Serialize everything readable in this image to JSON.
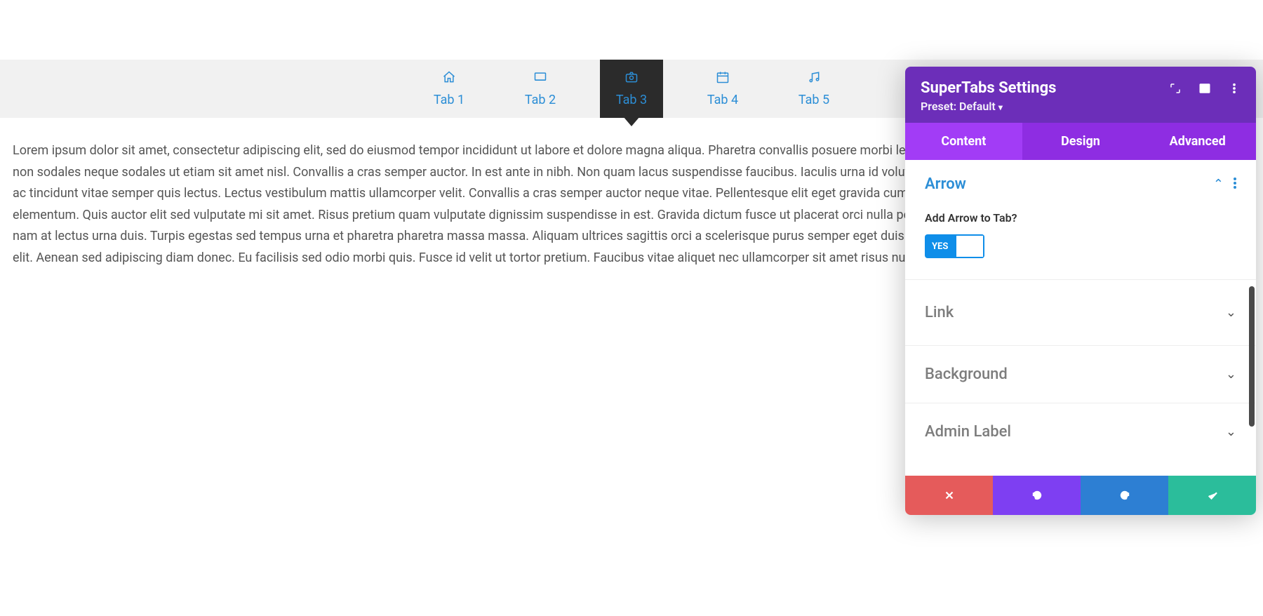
{
  "preview": {
    "tabs": [
      {
        "label": "Tab 1",
        "icon": "home",
        "active": false
      },
      {
        "label": "Tab 2",
        "icon": "monitor",
        "active": false
      },
      {
        "label": "Tab 3",
        "icon": "camera",
        "active": true
      },
      {
        "label": "Tab 4",
        "icon": "calendar",
        "active": false
      },
      {
        "label": "Tab 5",
        "icon": "music",
        "active": false
      }
    ],
    "content": "Lorem ipsum dolor sit amet, consectetur adipiscing elit, sed do eiusmod tempor incididunt ut labore et dolore magna aliqua. Pharetra convallis posuere morbi leo urna. Mi bibendum neque egestas congue quisque. Arcu non sodales neque sodales ut etiam sit amet nisl. Convallis a cras semper auctor. In est ante in nibh. Non quam lacus suspendisse faucibus. Iaculis urna id volutpat lacus laoreet non curabitur gravida arcu. Neque volutpat ac tincidunt vitae semper quis lectus. Lectus vestibulum mattis ullamcorper velit. Convallis a cras semper auctor neque vitae. Pellentesque elit eget gravida cum. Porttitor rhoncus dolor purus non enim praesent elementum. Quis auctor elit sed vulputate mi sit amet. Risus pretium quam vulputate dignissim suspendisse in est. Gravida dictum fusce ut placerat orci nulla pellentesque. Id volutpat lacus laoreet non. Consectetur a erat nam at lectus urna duis. Turpis egestas sed tempus urna et pharetra pharetra massa massa. Aliquam ultrices sagittis orci a scelerisque purus semper eget duis. Posuere lorem ipsum dolor sit amet consectetur adipiscing elit. Aenean sed adipiscing diam donec. Eu facilisis sed odio morbi quis. Fusce id velit ut tortor pretium. Faucibus vitae aliquet nec ullamcorper sit amet risus nullam eget. Eleifend mi in nulla posuere sollicitudin."
  },
  "panel": {
    "title": "SuperTabs Settings",
    "preset": "Preset: Default",
    "tabs": {
      "content": "Content",
      "design": "Design",
      "advanced": "Advanced"
    },
    "sections": {
      "arrow": {
        "title": "Arrow",
        "field": "Add Arrow to Tab?",
        "toggle": "YES"
      },
      "link": {
        "title": "Link"
      },
      "background": {
        "title": "Background"
      },
      "admin": {
        "title": "Admin Label"
      }
    }
  }
}
